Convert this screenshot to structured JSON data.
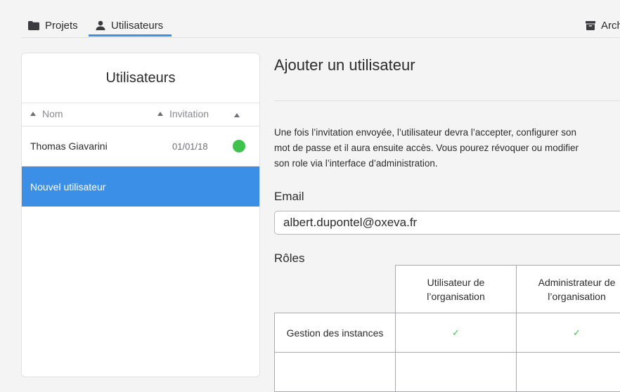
{
  "nav": {
    "tabs": [
      {
        "label": "Projets",
        "icon": "folder-icon",
        "active": false
      },
      {
        "label": "Utilisateurs",
        "icon": "user-icon",
        "active": true
      }
    ],
    "archives": {
      "label": "Archives",
      "icon": "archive-icon"
    }
  },
  "users_panel": {
    "title": "Utilisateurs",
    "columns": {
      "name": "Nom",
      "invitation": "Invitation"
    },
    "rows": [
      {
        "name": "Thomas Giavarini",
        "date": "01/01/18",
        "status": "accepted"
      }
    ],
    "new_user_label": "Nouvel utilisateur"
  },
  "form": {
    "title": "Ajouter un utilisateur",
    "description_lines": [
      "Une fois l’invitation envoyée, l’utilisateur devra l’accepter, configurer son",
      "mot de passe et il aura ensuite accès. Vous pourez révoquer ou modifier",
      "son role via l’interface d’administration."
    ],
    "email_label": "Email",
    "email_value": "albert.dupontel@oxeva.fr",
    "roles_label": "Rôles",
    "roles_table": {
      "columns": [
        {
          "line1": "Utilisateur de",
          "line2": "l’organisation"
        },
        {
          "line1": "Administrateur de",
          "line2": "l’organisation"
        }
      ],
      "rows": [
        {
          "label": "Gestion des instances",
          "values": [
            "✓",
            "✓"
          ]
        },
        {
          "label": "",
          "values": [
            "",
            ""
          ]
        }
      ]
    }
  },
  "colors": {
    "accent": "#3b8fe6",
    "status_green": "#3ec24b"
  }
}
